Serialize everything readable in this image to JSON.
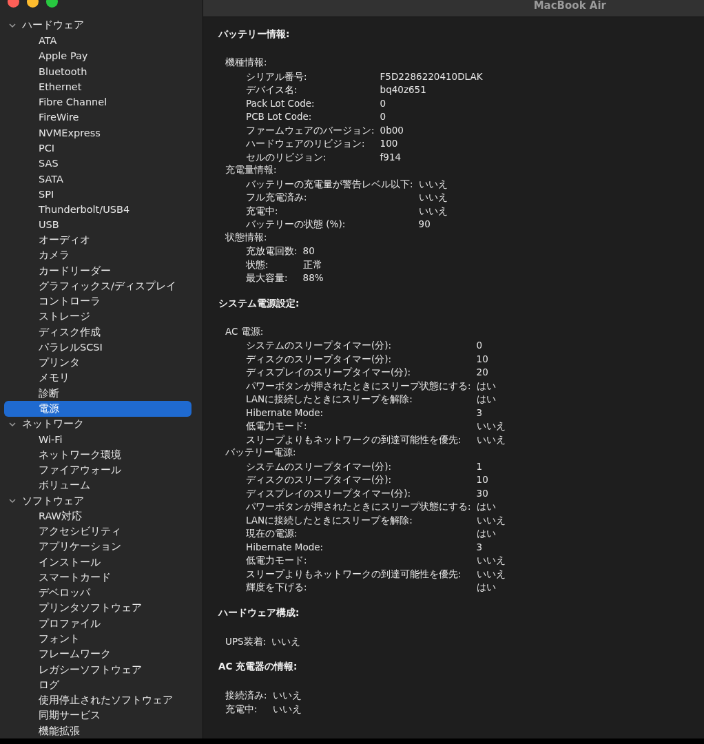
{
  "window": {
    "title": "MacBook Air"
  },
  "sidebar": {
    "groups": [
      {
        "label": "ハードウェア",
        "expanded": true,
        "children": [
          {
            "label": "ATA",
            "selected": false
          },
          {
            "label": "Apple Pay",
            "selected": false
          },
          {
            "label": "Bluetooth",
            "selected": false
          },
          {
            "label": "Ethernet",
            "selected": false
          },
          {
            "label": "Fibre Channel",
            "selected": false
          },
          {
            "label": "FireWire",
            "selected": false
          },
          {
            "label": "NVMExpress",
            "selected": false
          },
          {
            "label": "PCI",
            "selected": false
          },
          {
            "label": "SAS",
            "selected": false
          },
          {
            "label": "SATA",
            "selected": false
          },
          {
            "label": "SPI",
            "selected": false
          },
          {
            "label": "Thunderbolt/USB4",
            "selected": false
          },
          {
            "label": "USB",
            "selected": false
          },
          {
            "label": "オーディオ",
            "selected": false
          },
          {
            "label": "カメラ",
            "selected": false
          },
          {
            "label": "カードリーダー",
            "selected": false
          },
          {
            "label": "グラフィックス/ディスプレイ",
            "selected": false
          },
          {
            "label": "コントローラ",
            "selected": false
          },
          {
            "label": "ストレージ",
            "selected": false
          },
          {
            "label": "ディスク作成",
            "selected": false
          },
          {
            "label": "パラレルSCSI",
            "selected": false
          },
          {
            "label": "プリンタ",
            "selected": false
          },
          {
            "label": "メモリ",
            "selected": false
          },
          {
            "label": "診断",
            "selected": false
          },
          {
            "label": "電源",
            "selected": true
          }
        ]
      },
      {
        "label": "ネットワーク",
        "expanded": true,
        "children": [
          {
            "label": "Wi-Fi",
            "selected": false
          },
          {
            "label": "ネットワーク環境",
            "selected": false
          },
          {
            "label": "ファイアウォール",
            "selected": false
          },
          {
            "label": "ボリューム",
            "selected": false
          }
        ]
      },
      {
        "label": "ソフトウェア",
        "expanded": true,
        "children": [
          {
            "label": "RAW対応",
            "selected": false
          },
          {
            "label": "アクセシビリティ",
            "selected": false
          },
          {
            "label": "アプリケーション",
            "selected": false
          },
          {
            "label": "インストール",
            "selected": false
          },
          {
            "label": "スマートカード",
            "selected": false
          },
          {
            "label": "デベロッパ",
            "selected": false
          },
          {
            "label": "プリンタソフトウェア",
            "selected": false
          },
          {
            "label": "プロファイル",
            "selected": false
          },
          {
            "label": "フォント",
            "selected": false
          },
          {
            "label": "フレームワーク",
            "selected": false
          },
          {
            "label": "レガシーソフトウェア",
            "selected": false
          },
          {
            "label": "ログ",
            "selected": false
          },
          {
            "label": "使用停止されたソフトウェア",
            "selected": false
          },
          {
            "label": "同期サービス",
            "selected": false
          },
          {
            "label": "機能拡張",
            "selected": false
          }
        ]
      }
    ]
  },
  "content": {
    "sections": [
      {
        "title": "バッテリー情報:",
        "groups": [
          {
            "title": "機種情報:",
            "rows": [
              {
                "label": "シリアル番号:",
                "value": "F5D2286220410DLAK"
              },
              {
                "label": "デバイス名:",
                "value": "bq40z651"
              },
              {
                "label": "Pack Lot Code:",
                "value": "0"
              },
              {
                "label": "PCB Lot Code:",
                "value": "0"
              },
              {
                "label": "ファームウェアのバージョン:",
                "value": "0b00"
              },
              {
                "label": "ハードウェアのリビジョン:",
                "value": "100"
              },
              {
                "label": "セルのリビジョン:",
                "value": "f914"
              }
            ]
          },
          {
            "title": "充電量情報:",
            "rows": [
              {
                "label": "バッテリーの充電量が警告レベル以下:",
                "value": "いいえ"
              },
              {
                "label": "フル充電済み:",
                "value": "いいえ"
              },
              {
                "label": "充電中:",
                "value": "いいえ"
              },
              {
                "label": "バッテリーの状態 (%):",
                "value": "90"
              }
            ]
          },
          {
            "title": "状態情報:",
            "rows": [
              {
                "label": "充放電回数:",
                "value": "80"
              },
              {
                "label": "状態:",
                "value": "正常"
              },
              {
                "label": "最大容量:",
                "value": "88%"
              }
            ]
          }
        ]
      },
      {
        "title": "システム電源設定:",
        "groups": [
          {
            "title": "AC 電源:",
            "rows": [
              {
                "label": "システムのスリープタイマー(分):",
                "value": "0"
              },
              {
                "label": "ディスクのスリープタイマー(分):",
                "value": "10"
              },
              {
                "label": "ディスプレイのスリープタイマー(分):",
                "value": "20"
              },
              {
                "label": "パワーボタンが押されたときにスリープ状態にする:",
                "value": "はい"
              },
              {
                "label": "LANに接続したときにスリープを解除:",
                "value": "はい"
              },
              {
                "label": "Hibernate Mode:",
                "value": "3"
              },
              {
                "label": "低電力モード:",
                "value": "いいえ"
              },
              {
                "label": "スリープよりもネットワークの到達可能性を優先:",
                "value": "いいえ"
              }
            ]
          },
          {
            "title": "バッテリー電源:",
            "rows": [
              {
                "label": "システムのスリープタイマー(分):",
                "value": "1"
              },
              {
                "label": "ディスクのスリープタイマー(分):",
                "value": "10"
              },
              {
                "label": "ディスプレイのスリープタイマー(分):",
                "value": "30"
              },
              {
                "label": "パワーボタンが押されたときにスリープ状態にする:",
                "value": "はい"
              },
              {
                "label": "LANに接続したときにスリープを解除:",
                "value": "いいえ"
              },
              {
                "label": "現在の電源:",
                "value": "はい"
              },
              {
                "label": "Hibernate Mode:",
                "value": "3"
              },
              {
                "label": "低電力モード:",
                "value": "いいえ"
              },
              {
                "label": "スリープよりもネットワークの到達可能性を優先:",
                "value": "いいえ"
              },
              {
                "label": "輝度を下げる:",
                "value": "はい"
              }
            ]
          }
        ]
      },
      {
        "title": "ハードウェア構成:",
        "groups": [
          {
            "rows": [
              {
                "label": "UPS装着:",
                "value": "いいえ"
              }
            ]
          }
        ]
      },
      {
        "title": "AC 充電器の情報:",
        "groups": [
          {
            "rows": [
              {
                "label": "接続済み:",
                "value": "いいえ"
              },
              {
                "label": "充電中:",
                "value": "いいえ"
              }
            ]
          }
        ]
      }
    ]
  }
}
